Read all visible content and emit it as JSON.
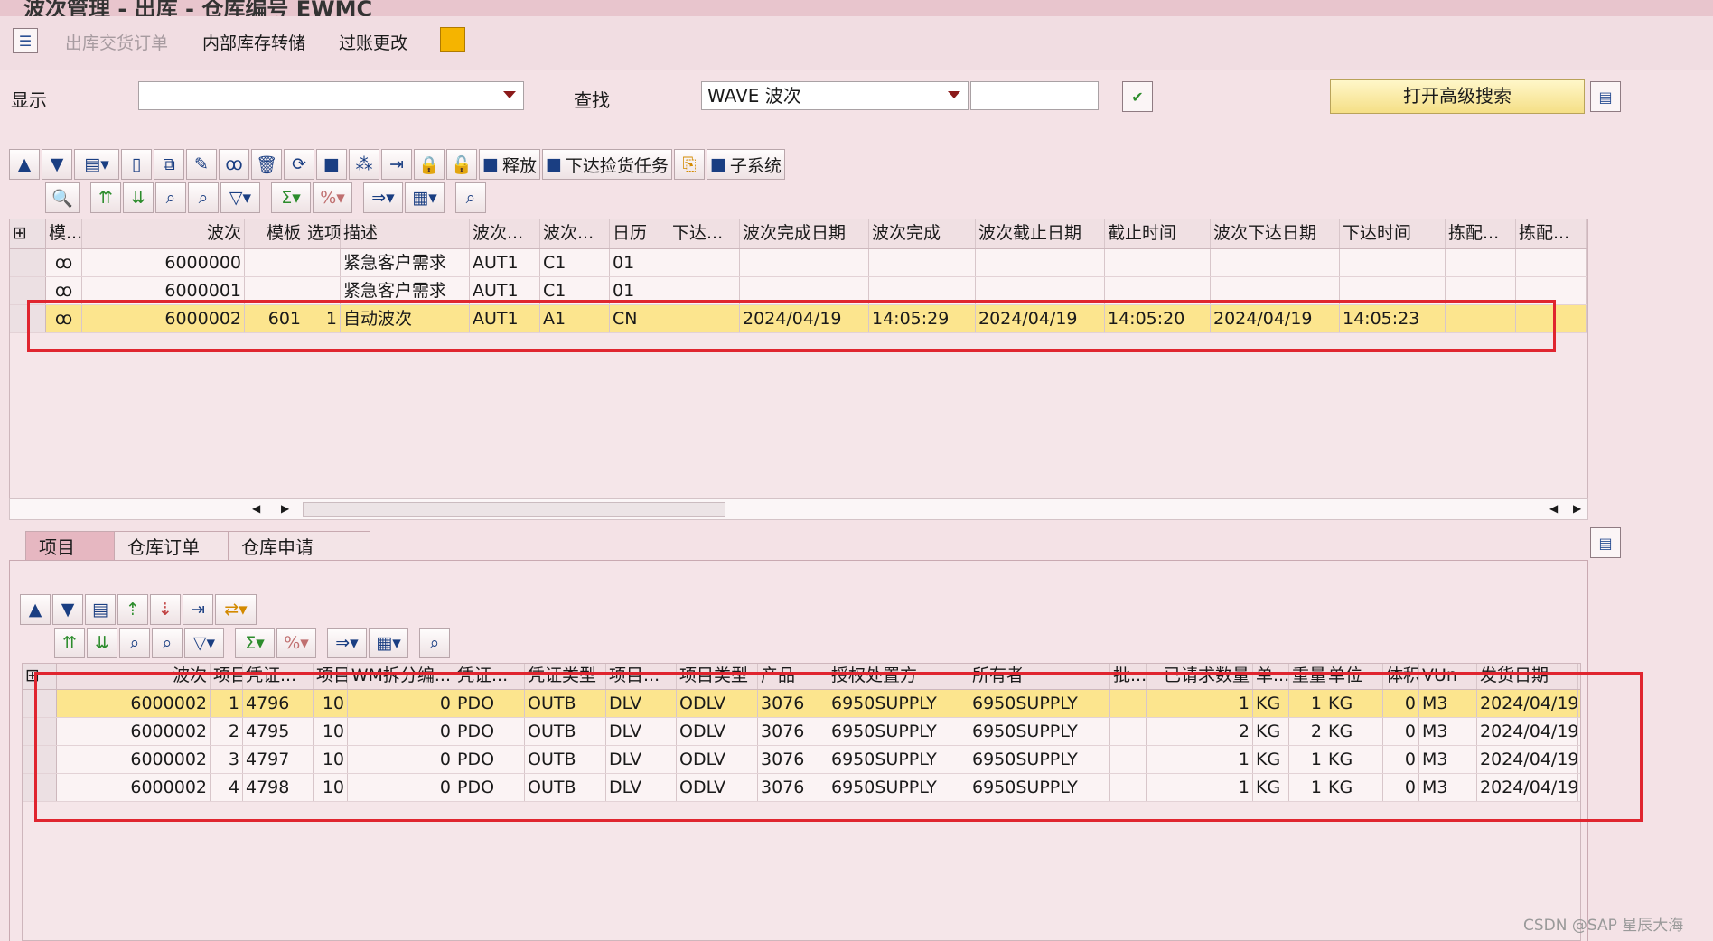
{
  "window": {
    "title": "波次管理 - 出库 - 仓库编号 EWMC"
  },
  "app_toolbar": {
    "items": [
      "出库交货订单",
      "内部库存转储",
      "过账更改"
    ]
  },
  "selection": {
    "show_label": "显示",
    "show_value": "",
    "find_label": "查找",
    "find_value": "WAVE 波次",
    "find_text": "",
    "adv_search": "打开高级搜索"
  },
  "main_toolbar": {
    "release": "释放",
    "release_pick": "下达捡货任务",
    "subsystem": "子系统"
  },
  "wave_grid": {
    "columns": [
      "模...",
      "波次",
      "模板",
      "选项",
      "描述",
      "波次...",
      "波次...",
      "日历",
      "下达...",
      "波次完成日期",
      "波次完成",
      "波次截止日期",
      "截止时间",
      "波次下达日期",
      "下达时间",
      "拣配...",
      "拣配..."
    ],
    "rows": [
      [
        "",
        "6000000",
        "",
        "",
        "紧急客户需求",
        "AUT1",
        "C1",
        "01",
        "",
        "",
        "",
        "",
        "",
        "",
        "",
        "",
        ""
      ],
      [
        "",
        "6000001",
        "",
        "",
        "紧急客户需求",
        "AUT1",
        "C1",
        "01",
        "",
        "",
        "",
        "",
        "",
        "",
        "",
        "",
        ""
      ],
      [
        "",
        "6000002",
        "601",
        "1",
        "自动波次",
        "AUT1",
        "A1",
        "CN",
        "",
        "2024/04/19",
        "14:05:29",
        "2024/04/19",
        "14:05:20",
        "2024/04/19",
        "14:05:23",
        "",
        ""
      ]
    ]
  },
  "tabs": [
    "项目",
    "仓库订单",
    "仓库申请"
  ],
  "item_grid": {
    "columns": [
      "波次",
      "项目",
      "凭证...",
      "项目",
      "WM拆分编...",
      "凭证...",
      "凭证类型",
      "项目...",
      "项目类型",
      "产品",
      "授权处置方",
      "所有者",
      "批...",
      "已请求数量",
      "单...",
      "重量",
      "单位",
      "体积",
      "VUn",
      "发货日期"
    ],
    "rows": [
      [
        "6000002",
        "1",
        "4796",
        "10",
        "0",
        "PDO",
        "OUTB",
        "DLV",
        "ODLV",
        "3076",
        "6950SUPPLY",
        "6950SUPPLY",
        "",
        "1",
        "KG",
        "1",
        "KG",
        "0",
        "M3",
        "2024/04/19"
      ],
      [
        "6000002",
        "2",
        "4795",
        "10",
        "0",
        "PDO",
        "OUTB",
        "DLV",
        "ODLV",
        "3076",
        "6950SUPPLY",
        "6950SUPPLY",
        "",
        "2",
        "KG",
        "2",
        "KG",
        "0",
        "M3",
        "2024/04/19"
      ],
      [
        "6000002",
        "3",
        "4797",
        "10",
        "0",
        "PDO",
        "OUTB",
        "DLV",
        "ODLV",
        "3076",
        "6950SUPPLY",
        "6950SUPPLY",
        "",
        "1",
        "KG",
        "1",
        "KG",
        "0",
        "M3",
        "2024/04/19"
      ],
      [
        "6000002",
        "4",
        "4798",
        "10",
        "0",
        "PDO",
        "OUTB",
        "DLV",
        "ODLV",
        "3076",
        "6950SUPPLY",
        "6950SUPPLY",
        "",
        "1",
        "KG",
        "1",
        "KG",
        "0",
        "M3",
        "2024/04/19"
      ]
    ]
  },
  "watermark": "CSDN @SAP 星辰大海"
}
